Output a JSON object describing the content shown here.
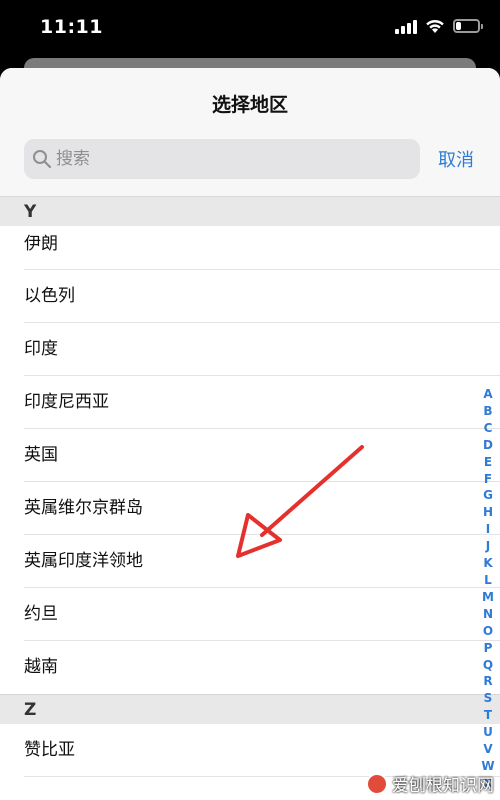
{
  "status_bar": {
    "time": "11:11",
    "battery_level": 0.25
  },
  "sheet": {
    "title": "选择地区",
    "search": {
      "placeholder": "搜索",
      "value": ""
    },
    "cancel_label": "取消"
  },
  "list": {
    "section_y": {
      "letter": "Y",
      "items": [
        "伊朗",
        "以色列",
        "印度",
        "印度尼西亚",
        "英国",
        "英属维尔京群岛",
        "英属印度洋领地",
        "约旦",
        "越南"
      ]
    },
    "section_z": {
      "letter": "Z",
      "items": [
        "赞比亚"
      ]
    }
  },
  "index_bar": [
    "A",
    "B",
    "C",
    "D",
    "E",
    "F",
    "G",
    "H",
    "I",
    "J",
    "K",
    "L",
    "M",
    "N",
    "O",
    "P",
    "Q",
    "R",
    "S",
    "T",
    "U",
    "V",
    "W",
    "X"
  ],
  "watermark": {
    "text": "爱刨根知识网"
  },
  "colors": {
    "accent": "#2f7bd6",
    "annotation": "#e5312d"
  },
  "icons": {
    "search": "search-icon",
    "signal": "cellular-signal-icon",
    "wifi": "wifi-icon",
    "battery": "battery-icon"
  }
}
